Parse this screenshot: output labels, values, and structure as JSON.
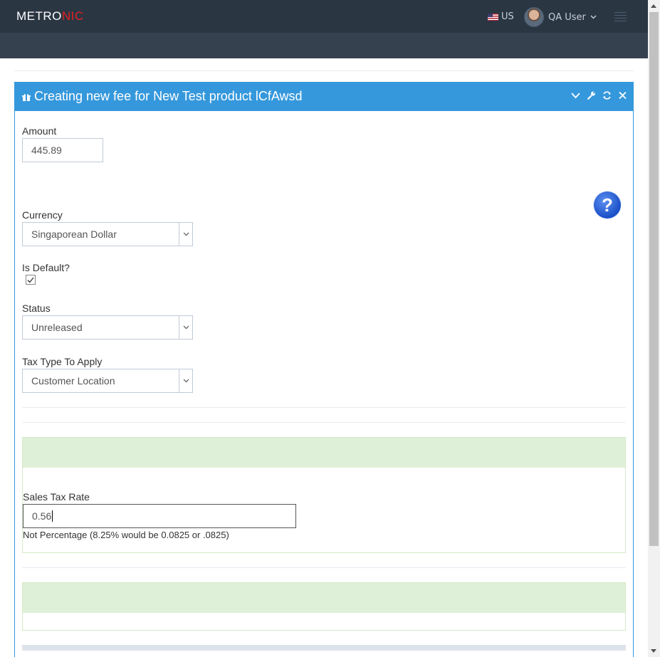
{
  "header": {
    "logo_main": "METRO",
    "logo_accent": "NIC",
    "language": "US",
    "user_name": "QA User"
  },
  "portlet": {
    "title": "Creating new fee for New Test product lCfAwsd",
    "help_glyph": "?"
  },
  "form": {
    "amount_label": "Amount",
    "amount_value": "445.89",
    "currency_label": "Currency",
    "currency_value": "Singaporean Dollar",
    "is_default_label": "Is Default?",
    "is_default_checked": true,
    "status_label": "Status",
    "status_value": "Unreleased",
    "tax_type_label": "Tax Type To Apply",
    "tax_type_value": "Customer Location",
    "sales_tax_label": "Sales Tax Rate",
    "sales_tax_value": "0.56",
    "sales_tax_help": "Not Percentage (8.25% would be 0.0825 or .0825)"
  },
  "colors": {
    "topbar": "#2b3643",
    "subbar": "#364150",
    "portlet_blue": "#3598dc",
    "logo_accent": "#e02222",
    "success_bg": "#dff0d8",
    "success_border": "#d6e9c6"
  },
  "icons": [
    "gift-icon",
    "chevron-down-icon",
    "wrench-icon",
    "refresh-icon",
    "close-icon",
    "help-icon",
    "menu-icon",
    "flag-us-icon",
    "checkmark-icon"
  ]
}
